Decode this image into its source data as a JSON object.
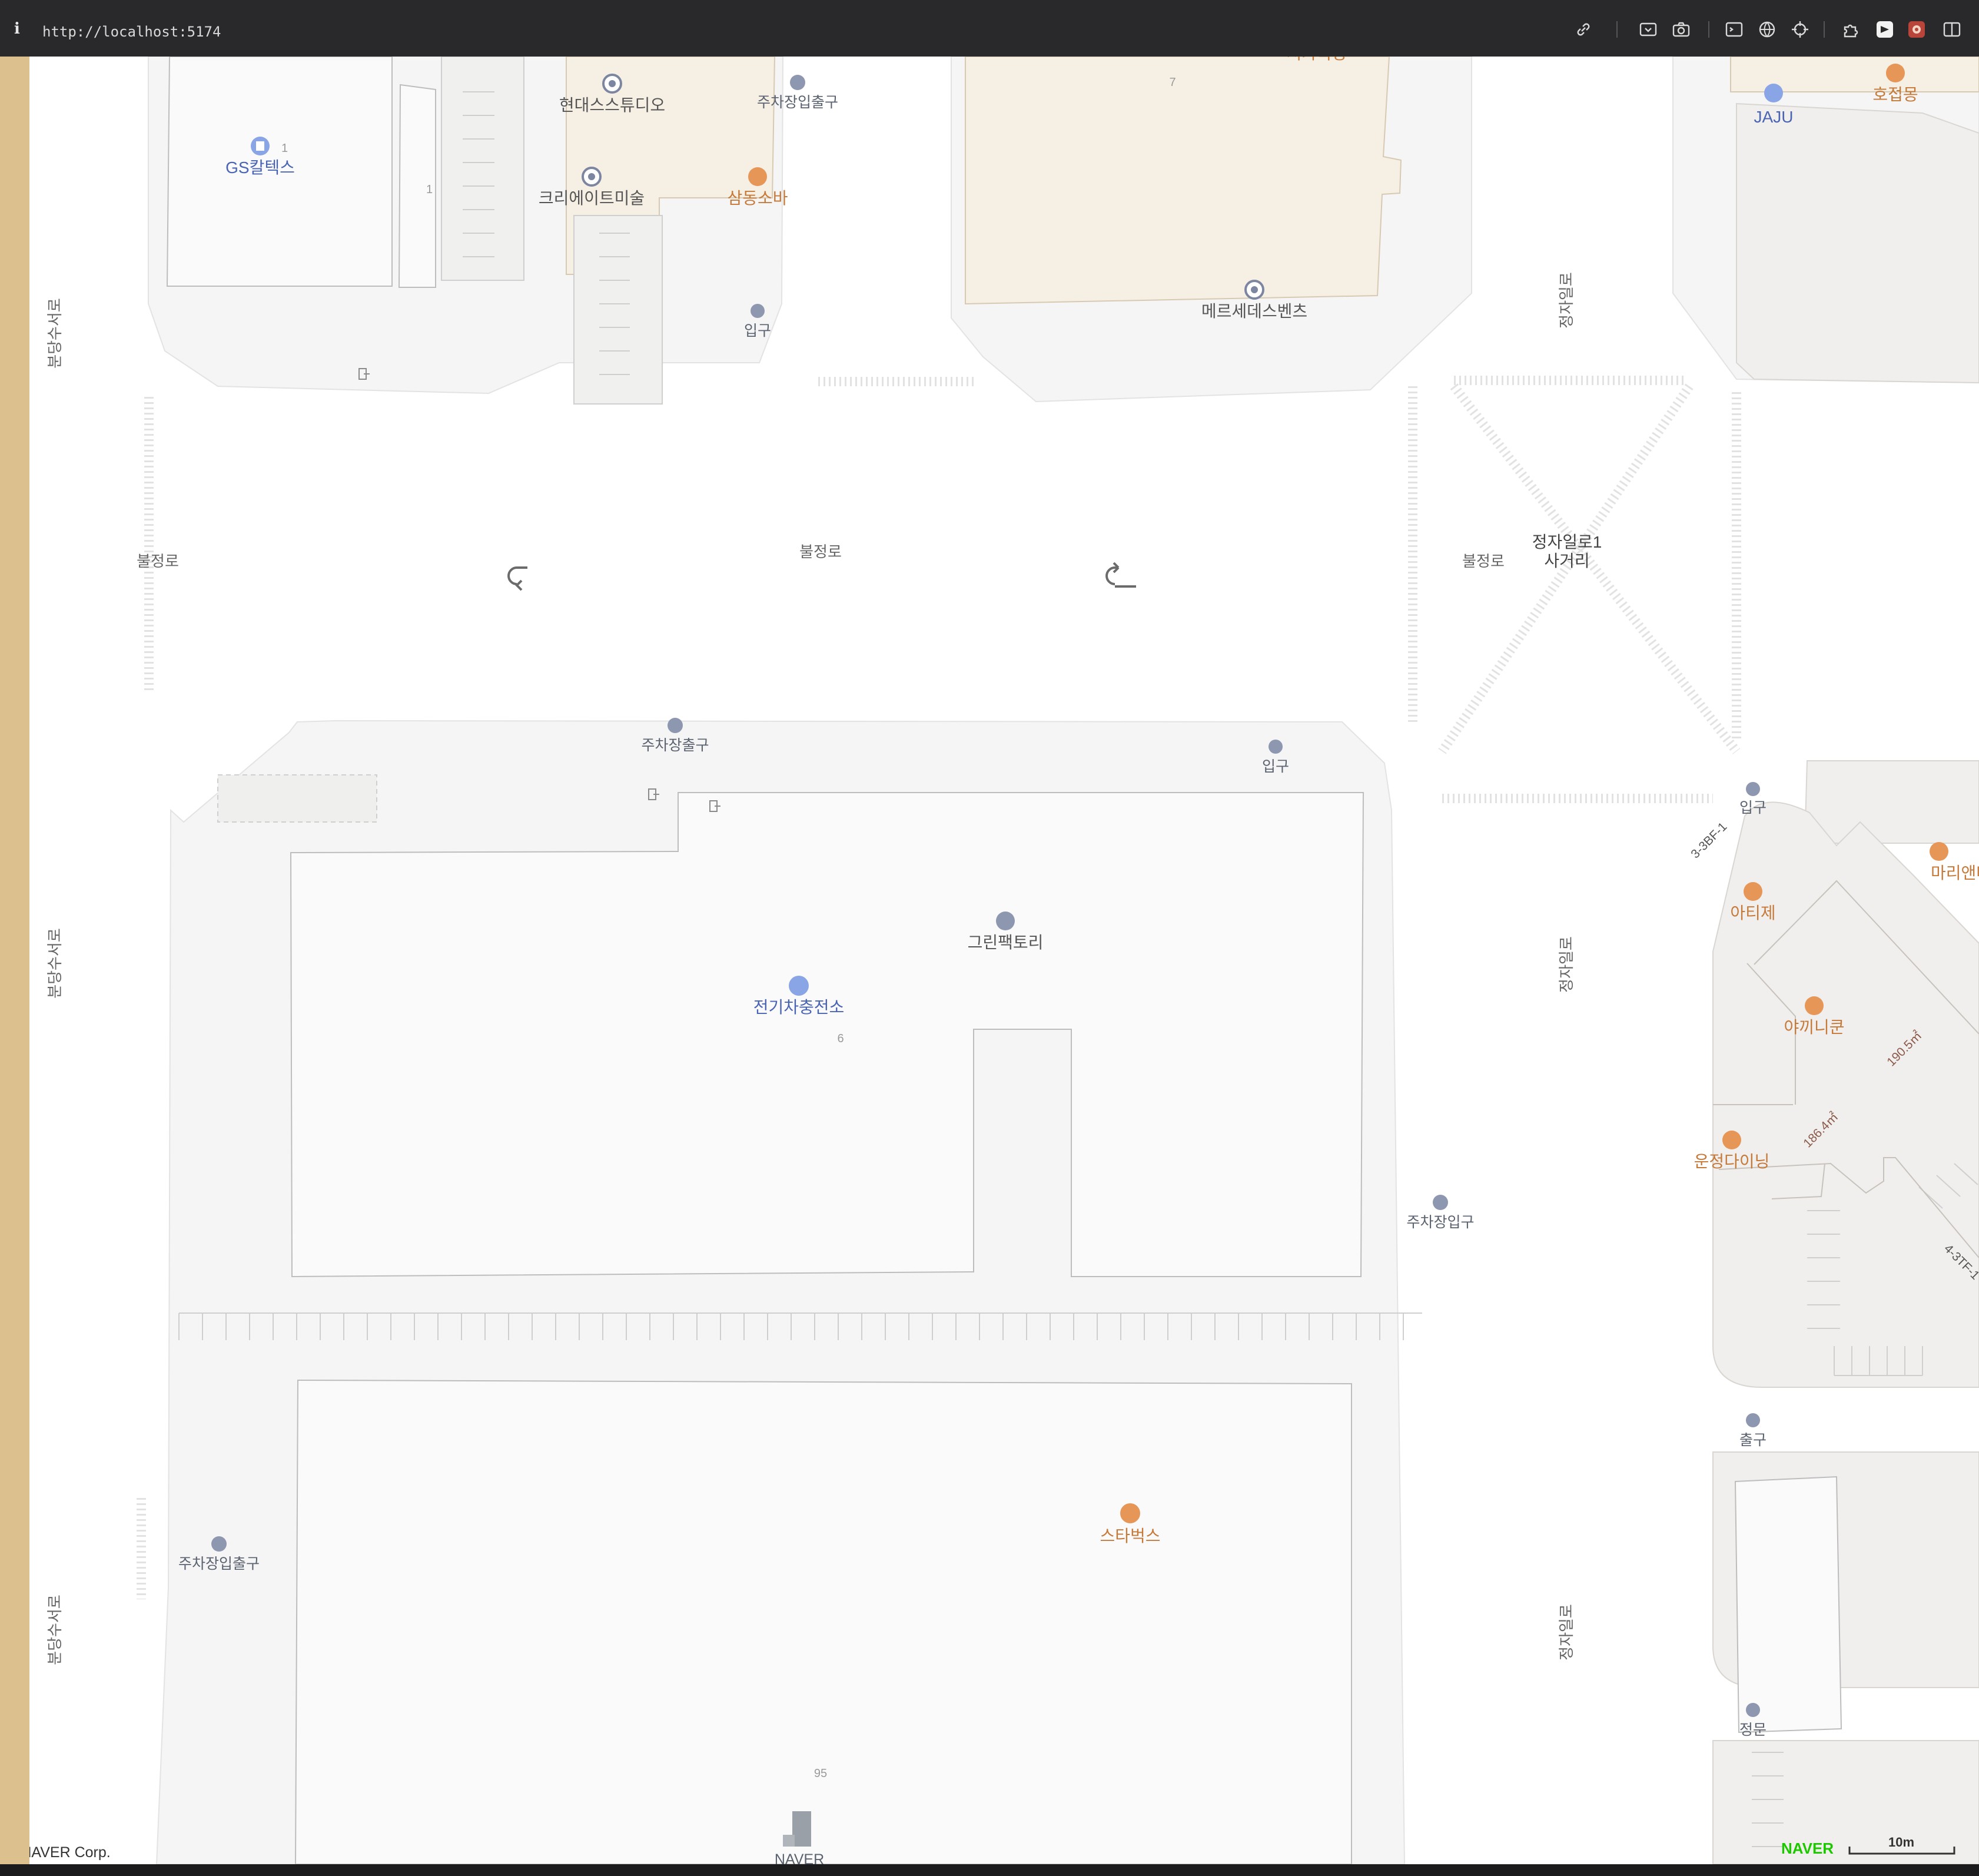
{
  "browser": {
    "info_icon": "info-icon",
    "url": "http://localhost:5174",
    "toolbar_icons": [
      "link-icon",
      "screenshot-region-icon",
      "camera-icon",
      "terminal-icon",
      "globe-icon",
      "crosshair-icon",
      "extensions-icon",
      "extension-active-icon",
      "extension-red-icon",
      "sidebar-icon"
    ]
  },
  "map": {
    "roads": {
      "west_1": "분당수서로",
      "west_2": "분당수서로",
      "west_3": "분당수서로",
      "bul_1": "불정로",
      "bul_2": "불정로",
      "bul_3": "불정로",
      "jeong_1": "정자일로",
      "jeong_2": "정자일로",
      "jeong_3": "정자일로",
      "intersection_line1": "정자일로1",
      "intersection_line2": "사거리"
    },
    "pois": {
      "gs": "GS칼텍스",
      "hyundai": "현대스스튜디오",
      "parking_io_top": "주차장입출구",
      "create": "크리에이트미술",
      "samdong": "삼동소바",
      "entrance_top": "입구",
      "mercedes": "메르세데스벤츠",
      "top_cut": "서가육장",
      "jaju": "JAJU",
      "hojeop": "호접몽",
      "parking_exit": "주차장출구",
      "entrance_mid": "입구",
      "entrance_right": "입구",
      "green": "그린팩토리",
      "ev": "전기차충전소",
      "marie": "마리앤마사",
      "atije": "아티제",
      "akkinikun": "야끼니쿤",
      "unjeong": "운정다이닝",
      "parking_entrance": "주차장입구",
      "exit": "출구",
      "parking_io_left": "주차장입출구",
      "starbucks": "스타벅스",
      "main_gate": "정문",
      "naver_tower": "NAVER"
    },
    "numbers": {
      "gs_no": "1",
      "gs_no2": "1",
      "mercedes_no": "7",
      "block_no": "6",
      "bottom_no": "95"
    },
    "areas": {
      "a1": "190.5㎡",
      "a2": "186.4㎡",
      "floor1": "3-3BF-1",
      "floor2": "4-3TF-1"
    },
    "footer": {
      "copyright": "© NAVER Corp.",
      "logo": "NAVER",
      "scale": "10m"
    },
    "colors": {
      "building_tan": "#f6efe4",
      "block_gray": "#f5f5f5",
      "poi_blue": "#5a6ea8",
      "poi_orange": "#c57a3a",
      "naver_green": "#1ec800",
      "left_strip": "#dcc18f"
    }
  }
}
